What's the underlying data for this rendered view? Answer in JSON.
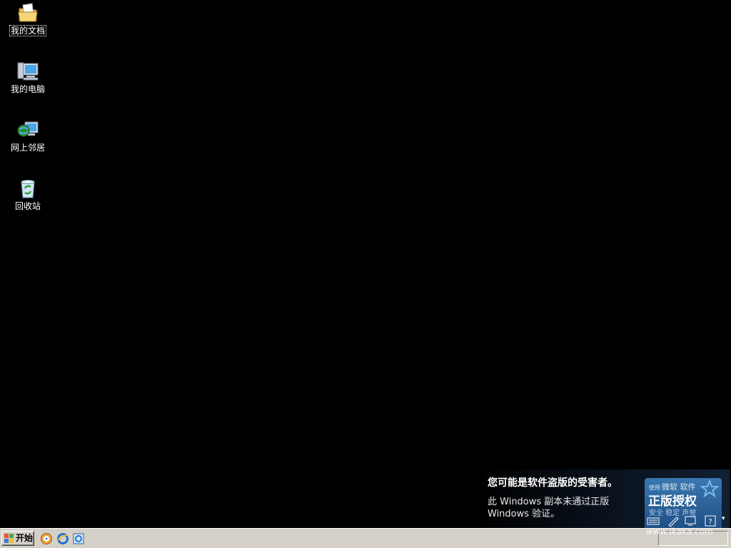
{
  "desktop": {
    "icons": [
      {
        "label": "我的文档",
        "icon": "my-documents-icon"
      },
      {
        "label": "我的电脑",
        "icon": "my-computer-icon"
      },
      {
        "label": "网上邻居",
        "icon": "network-places-icon"
      },
      {
        "label": "回收站",
        "icon": "recycle-bin-icon"
      }
    ]
  },
  "notice": {
    "headline": "您可能是软件盗版的受害者。",
    "line1": "此 Windows 副本未通过正版",
    "line2": "Windows 验证。",
    "badge_small": "使用",
    "badge_brand": "微软 软件",
    "badge_title": "正版授权",
    "badge_tail": "安全 稳定 声誉"
  },
  "taskbar": {
    "start_label": "开始",
    "quick_launch": [
      "media-player-icon",
      "internet-explorer-icon",
      "ie-alt-icon"
    ],
    "tray_icons": [
      "keyboard-icon",
      "pen-icon",
      "monitor-icon",
      "help-icon"
    ]
  },
  "watermark": "www.ikaka.com",
  "colors": {
    "desktop": "#000000",
    "taskbar": "#d4d0c8",
    "badge": "#2b5f98"
  }
}
